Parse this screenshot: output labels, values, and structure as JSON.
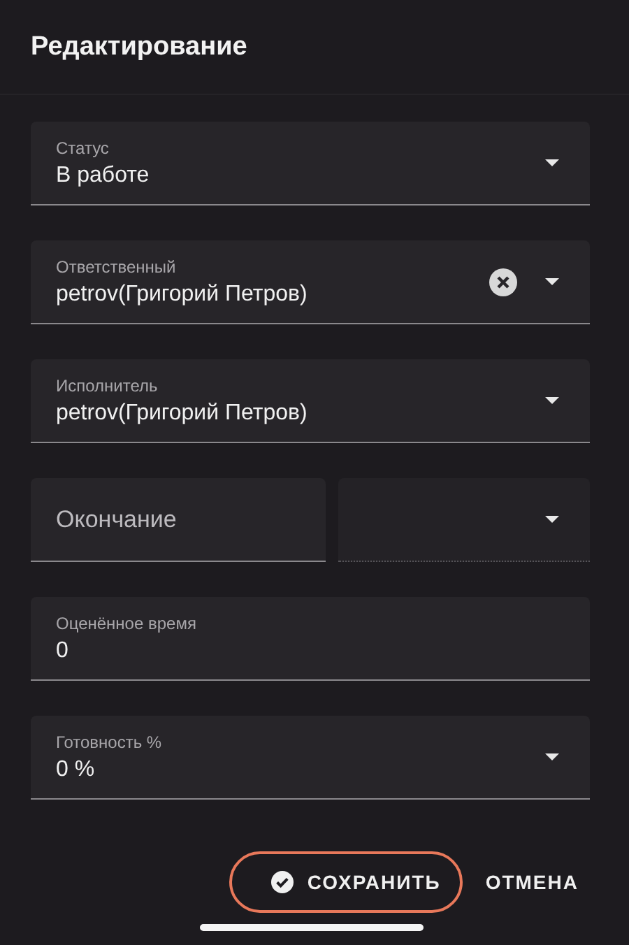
{
  "dialog": {
    "title": "Редактирование"
  },
  "fields": [
    {
      "kind": "select",
      "label": "Статус",
      "value": "В работе",
      "clearable": false
    },
    {
      "kind": "select",
      "label": "Ответственный",
      "value": "petrov(Григорий Петров)",
      "clearable": true
    },
    {
      "kind": "select",
      "label": "Исполнитель",
      "value": "petrov(Григорий Петров)",
      "clearable": false
    },
    {
      "kind": "date",
      "placeholder": "Окончание"
    },
    {
      "kind": "text",
      "label": "Оценённое время",
      "value": "0"
    },
    {
      "kind": "select",
      "label": "Готовность %",
      "value": "0 %",
      "clearable": false
    }
  ],
  "buttons": [
    {
      "kind": "save",
      "label": "СОХРАНИТЬ",
      "highlighted": true
    },
    {
      "kind": "cancel",
      "label": "ОТМЕНА",
      "highlighted": false
    }
  ]
}
